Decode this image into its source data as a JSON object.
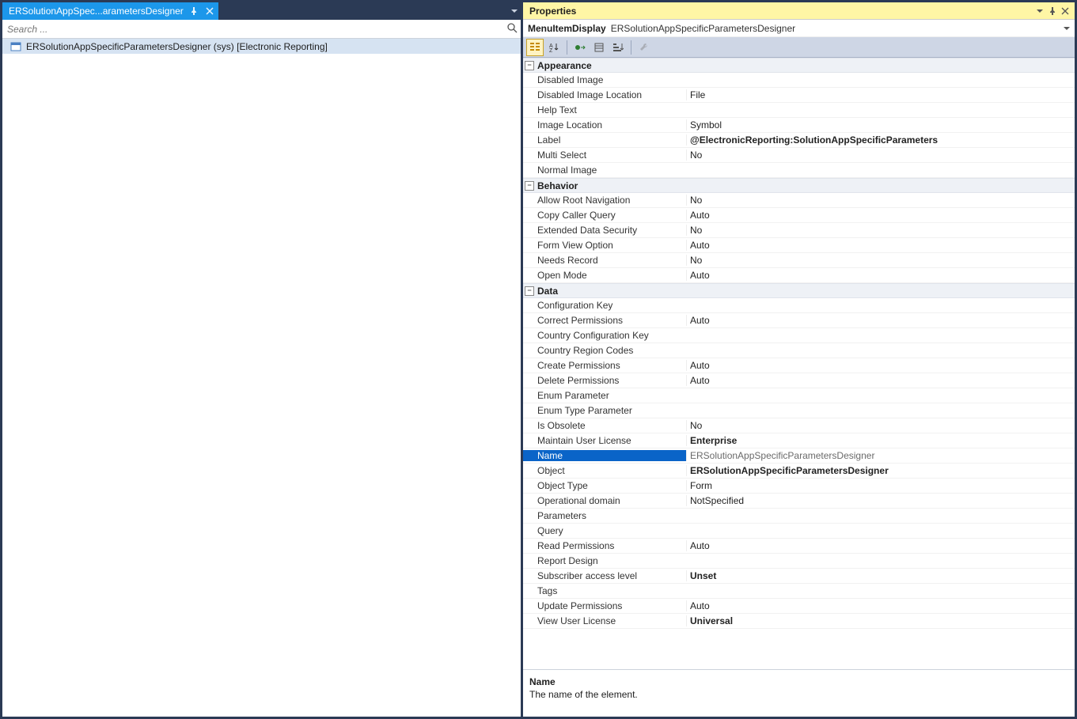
{
  "left": {
    "tab_title": "ERSolutionAppSpec...arametersDesigner",
    "search_placeholder": "Search ...",
    "tree_item": "ERSolutionAppSpecificParametersDesigner (sys) [Electronic Reporting]"
  },
  "props": {
    "title": "Properties",
    "object_type": "MenuItemDisplay",
    "object_name": "ERSolutionAppSpecificParametersDesigner"
  },
  "categories": [
    {
      "name": "Appearance",
      "rows": [
        {
          "name": "Disabled Image",
          "value": "",
          "bold": false,
          "selected": false
        },
        {
          "name": "Disabled Image Location",
          "value": "File",
          "bold": false,
          "selected": false
        },
        {
          "name": "Help Text",
          "value": "",
          "bold": false,
          "selected": false
        },
        {
          "name": "Image Location",
          "value": "Symbol",
          "bold": false,
          "selected": false
        },
        {
          "name": "Label",
          "value": "@ElectronicReporting:SolutionAppSpecificParameters",
          "bold": true,
          "selected": false
        },
        {
          "name": "Multi Select",
          "value": "No",
          "bold": false,
          "selected": false
        },
        {
          "name": "Normal Image",
          "value": "",
          "bold": false,
          "selected": false
        }
      ]
    },
    {
      "name": "Behavior",
      "rows": [
        {
          "name": "Allow Root Navigation",
          "value": "No",
          "bold": false,
          "selected": false
        },
        {
          "name": "Copy Caller Query",
          "value": "Auto",
          "bold": false,
          "selected": false
        },
        {
          "name": "Extended Data Security",
          "value": "No",
          "bold": false,
          "selected": false
        },
        {
          "name": "Form View Option",
          "value": "Auto",
          "bold": false,
          "selected": false
        },
        {
          "name": "Needs Record",
          "value": "No",
          "bold": false,
          "selected": false
        },
        {
          "name": "Open Mode",
          "value": "Auto",
          "bold": false,
          "selected": false
        }
      ]
    },
    {
      "name": "Data",
      "rows": [
        {
          "name": "Configuration Key",
          "value": "",
          "bold": false,
          "selected": false
        },
        {
          "name": "Correct Permissions",
          "value": "Auto",
          "bold": false,
          "selected": false
        },
        {
          "name": "Country Configuration Key",
          "value": "",
          "bold": false,
          "selected": false
        },
        {
          "name": "Country Region Codes",
          "value": "",
          "bold": false,
          "selected": false
        },
        {
          "name": "Create Permissions",
          "value": "Auto",
          "bold": false,
          "selected": false
        },
        {
          "name": "Delete Permissions",
          "value": "Auto",
          "bold": false,
          "selected": false
        },
        {
          "name": "Enum Parameter",
          "value": "",
          "bold": false,
          "selected": false
        },
        {
          "name": "Enum Type Parameter",
          "value": "",
          "bold": false,
          "selected": false
        },
        {
          "name": "Is Obsolete",
          "value": "No",
          "bold": false,
          "selected": false
        },
        {
          "name": "Maintain User License",
          "value": "Enterprise",
          "bold": true,
          "selected": false
        },
        {
          "name": "Name",
          "value": "ERSolutionAppSpecificParametersDesigner",
          "bold": false,
          "selected": true
        },
        {
          "name": "Object",
          "value": "ERSolutionAppSpecificParametersDesigner",
          "bold": true,
          "selected": false
        },
        {
          "name": "Object Type",
          "value": "Form",
          "bold": false,
          "selected": false
        },
        {
          "name": "Operational domain",
          "value": "NotSpecified",
          "bold": false,
          "selected": false
        },
        {
          "name": "Parameters",
          "value": "",
          "bold": false,
          "selected": false
        },
        {
          "name": "Query",
          "value": "",
          "bold": false,
          "selected": false
        },
        {
          "name": "Read Permissions",
          "value": "Auto",
          "bold": false,
          "selected": false
        },
        {
          "name": "Report Design",
          "value": "",
          "bold": false,
          "selected": false
        },
        {
          "name": "Subscriber access level",
          "value": "Unset",
          "bold": true,
          "selected": false
        },
        {
          "name": "Tags",
          "value": "",
          "bold": false,
          "selected": false
        },
        {
          "name": "Update Permissions",
          "value": "Auto",
          "bold": false,
          "selected": false
        },
        {
          "name": "View User License",
          "value": "Universal",
          "bold": true,
          "selected": false
        }
      ]
    }
  ],
  "description": {
    "name": "Name",
    "text": "The name of the element."
  }
}
